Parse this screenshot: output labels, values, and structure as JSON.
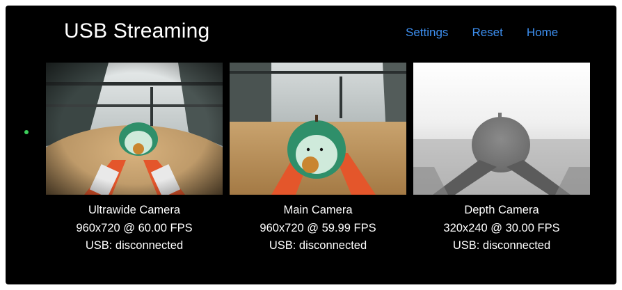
{
  "header": {
    "title": "USB Streaming",
    "nav": {
      "settings_label": "Settings",
      "reset_label": "Reset",
      "home_label": "Home"
    }
  },
  "colors": {
    "background": "#000000",
    "accent": "#3d8ff0",
    "status_dot": "#3ccf5b"
  },
  "cameras": [
    {
      "name": "Ultrawide Camera",
      "resolution": "960x720 @ 60.00 FPS",
      "usb_status": "USB: disconnected"
    },
    {
      "name": "Main Camera",
      "resolution": "960x720 @ 59.99 FPS",
      "usb_status": "USB: disconnected"
    },
    {
      "name": "Depth Camera",
      "resolution": "320x240 @ 30.00 FPS",
      "usb_status": "USB: disconnected"
    }
  ]
}
